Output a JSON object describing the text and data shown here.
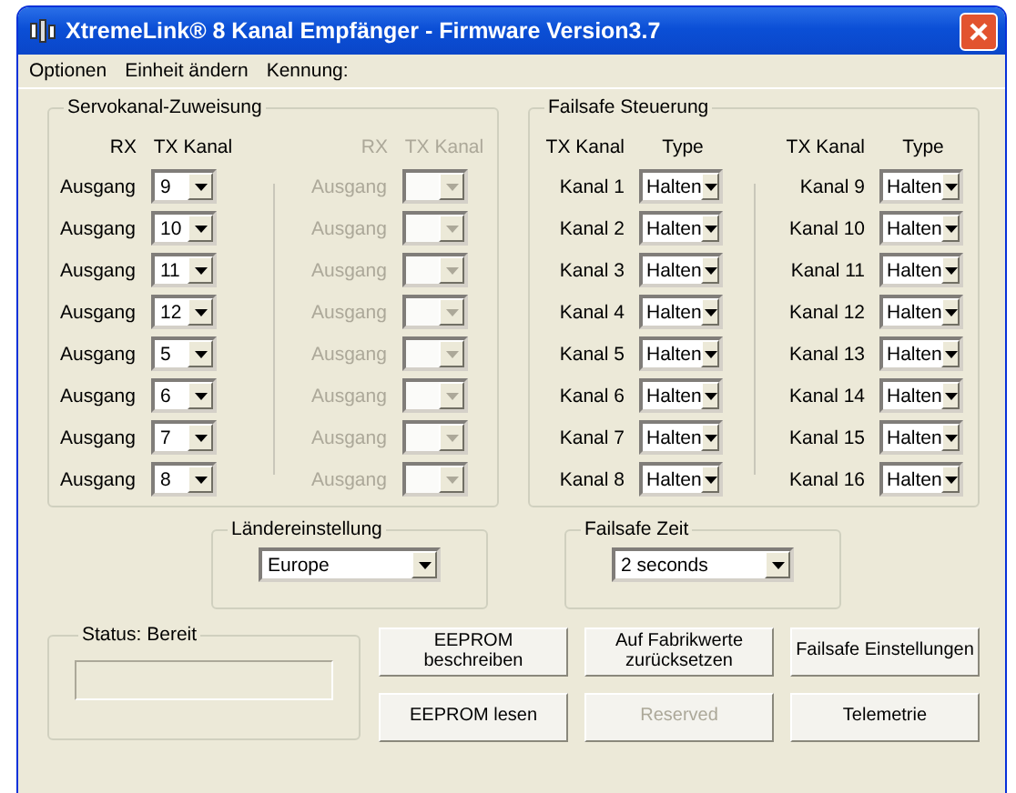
{
  "window": {
    "title": "XtremeLink® 8 Kanal Empfänger - Firmware Version3.7"
  },
  "menu": [
    "Optionen",
    "Einheit ändern",
    "Kennung:"
  ],
  "servo": {
    "title": "Servokanal-Zuweisung",
    "columns": [
      {
        "disabled": false,
        "headers": [
          "RX",
          "TX Kanal"
        ],
        "rows": [
          {
            "label": "Ausgang",
            "value": "9"
          },
          {
            "label": "Ausgang",
            "value": "10"
          },
          {
            "label": "Ausgang",
            "value": "11"
          },
          {
            "label": "Ausgang",
            "value": "12"
          },
          {
            "label": "Ausgang",
            "value": "5"
          },
          {
            "label": "Ausgang",
            "value": "6"
          },
          {
            "label": "Ausgang",
            "value": "7"
          },
          {
            "label": "Ausgang",
            "value": "8"
          }
        ]
      },
      {
        "disabled": true,
        "headers": [
          "RX",
          "TX Kanal"
        ],
        "rows": [
          {
            "label": "Ausgang"
          },
          {
            "label": "Ausgang"
          },
          {
            "label": "Ausgang"
          },
          {
            "label": "Ausgang"
          },
          {
            "label": "Ausgang"
          },
          {
            "label": "Ausgang"
          },
          {
            "label": "Ausgang"
          },
          {
            "label": "Ausgang"
          }
        ]
      }
    ]
  },
  "failsafe": {
    "title": "Failsafe Steuerung",
    "columns": [
      {
        "disabled": false,
        "headers": [
          "TX Kanal",
          "Type"
        ],
        "rows": [
          {
            "label": "Kanal 1",
            "value": "Halten"
          },
          {
            "label": "Kanal 2",
            "value": "Halten"
          },
          {
            "label": "Kanal 3",
            "value": "Halten"
          },
          {
            "label": "Kanal 4",
            "value": "Halten"
          },
          {
            "label": "Kanal 5",
            "value": "Halten"
          },
          {
            "label": "Kanal 6",
            "value": "Halten"
          },
          {
            "label": "Kanal 7",
            "value": "Halten"
          },
          {
            "label": "Kanal 8",
            "value": "Halten"
          }
        ]
      },
      {
        "disabled": false,
        "headers": [
          "TX Kanal",
          "Type"
        ],
        "rows": [
          {
            "label": "Kanal 9",
            "value": "Halten"
          },
          {
            "label": "Kanal 10",
            "value": "Halten"
          },
          {
            "label": "Kanal 11",
            "value": "Halten"
          },
          {
            "label": "Kanal 12",
            "value": "Halten"
          },
          {
            "label": "Kanal 13",
            "value": "Halten"
          },
          {
            "label": "Kanal 14",
            "value": "Halten"
          },
          {
            "label": "Kanal 15",
            "value": "Halten"
          },
          {
            "label": "Kanal 16",
            "value": "Halten"
          }
        ]
      }
    ]
  },
  "country": {
    "title": "Ländereinstellung",
    "value": "Europe"
  },
  "failsafe_time": {
    "title": "Failsafe Zeit",
    "value": "2 seconds"
  },
  "status": {
    "title": "Status: Bereit"
  },
  "buttons": [
    {
      "label": "EEPROM beschreiben",
      "disabled": false
    },
    {
      "label": "Auf Fabrikwerte zurücksetzen",
      "disabled": false
    },
    {
      "label": "Failsafe Einstellungen",
      "disabled": false
    },
    {
      "label": "EEPROM lesen",
      "disabled": false
    },
    {
      "label": "Reserved",
      "disabled": true
    },
    {
      "label": "Telemetrie",
      "disabled": false
    }
  ]
}
